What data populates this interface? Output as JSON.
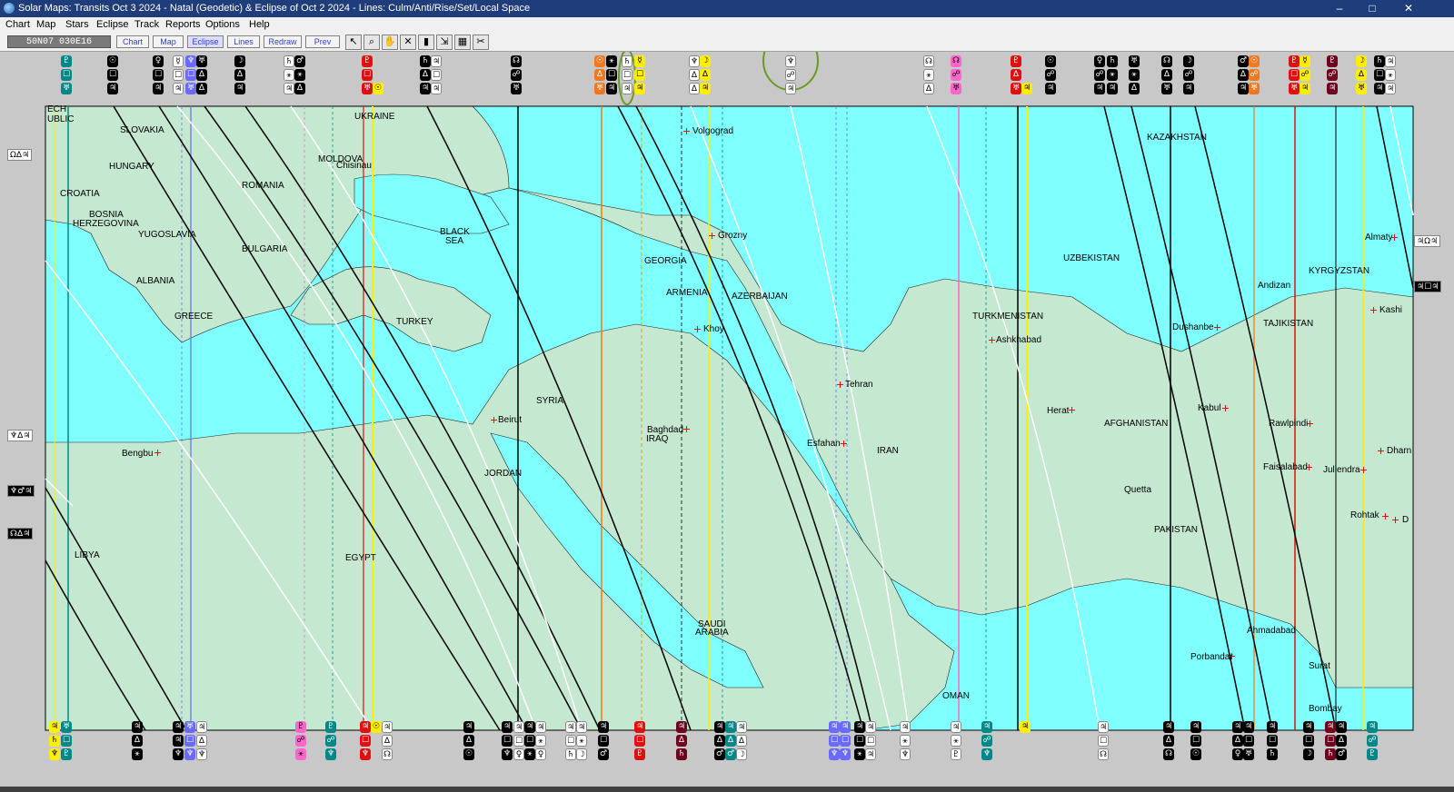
{
  "window": {
    "title": "Solar Maps: Transits Oct 3 2024 - Natal (Geodetic)  & Eclipse of Oct 2 2024 - Lines: Culm/Anti/Rise/Set/Local Space",
    "minimize": "–",
    "maximize": "□",
    "close": "✕"
  },
  "menu": [
    "Chart",
    "Map",
    "Stars",
    "Eclipse",
    "Track",
    "Reports",
    "Options",
    "Help"
  ],
  "toolbar": {
    "coords": "50N07 030E16",
    "buttons": [
      "Chart",
      "Map",
      "Eclipse",
      "Lines",
      "Redraw",
      "Prev"
    ],
    "icons": [
      "cursor-icon",
      "zoom-icon",
      "hand-icon",
      "cross-icon",
      "marker-icon",
      "arrows-icon",
      "grid-icon",
      "scissors-icon"
    ]
  },
  "colors": {
    "sea": "#80ffff",
    "land": "#c4e8d0",
    "frame": "#c8c8c8",
    "highlight_circle": "#6a9a20"
  },
  "countries": [
    "ECH",
    "UBLIC",
    "SLOVAKIA",
    "UKRAINE",
    "HUNGARY",
    "MOLDOVA",
    "CROATIA",
    "ROMANIA",
    "BOSNIA",
    "HERZEGOVINA",
    "YUGOSLAVIA",
    "BULGARIA",
    "BLACK",
    "SEA",
    "ALBANIA",
    "GREECE",
    "TURKEY",
    "GEORGIA",
    "ARMENIA",
    "AZERBAIJAN",
    "SYRIA",
    "IRAQ",
    "JORDAN",
    "EGYPT",
    "LIBYA",
    "SAUDI",
    "ARABIA",
    "IRAN",
    "TURKMENISTAN",
    "UZBEKISTAN",
    "KAZAKHSTAN",
    "KYRGYZSTAN",
    "TAJIKISTAN",
    "AFGHANISTAN",
    "PAKISTAN",
    "OMAN"
  ],
  "cities": [
    "Volgograd",
    "Grozny",
    "Khoy",
    "Tehran",
    "Esfahan",
    "Baghdad",
    "Beirut",
    "Bengbu",
    "Ashkhabad",
    "Herat",
    "Quetta",
    "Kabul",
    "Dushanbe",
    "Andizan",
    "Almaty",
    "Kashi",
    "Rawlpindi",
    "Faisalabad",
    "Jullendra",
    "Dharn",
    "Rohtak",
    "D",
    "Ahmadabad",
    "Porbandar",
    "Surat",
    "Bombay",
    "Chisinau"
  ],
  "left_labels": [
    "ΩΔ♃",
    "♆Δ♃",
    "♆♂♃",
    "☊Δ♃"
  ],
  "right_labels": [
    "♃Ω♃",
    "♃☐♃"
  ]
}
